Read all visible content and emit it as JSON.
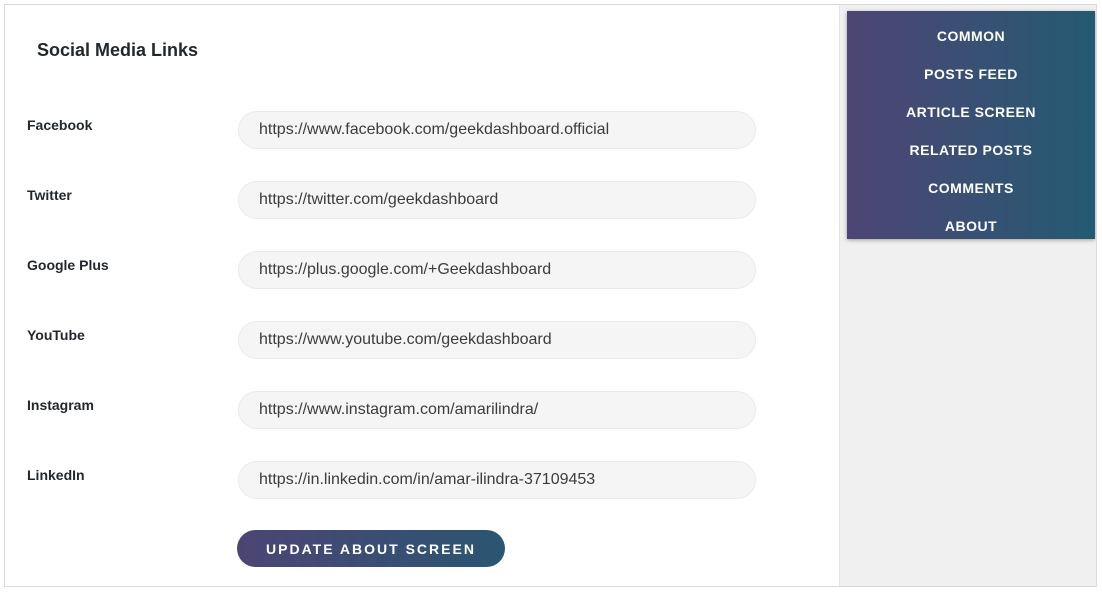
{
  "section": {
    "title": "Social Media Links"
  },
  "fields": [
    {
      "label": "Facebook",
      "value": "https://www.facebook.com/geekdashboard.official"
    },
    {
      "label": "Twitter",
      "value": "https://twitter.com/geekdashboard"
    },
    {
      "label": "Google Plus",
      "value": "https://plus.google.com/+Geekdashboard"
    },
    {
      "label": "YouTube",
      "value": "https://www.youtube.com/geekdashboard"
    },
    {
      "label": "Instagram",
      "value": "https://www.instagram.com/amarilindra/"
    },
    {
      "label": "LinkedIn",
      "value": "https://in.linkedin.com/in/amar-ilindra-37109453"
    }
  ],
  "actions": {
    "update_label": "UPDATE ABOUT SCREEN"
  },
  "menu": {
    "items": [
      {
        "label": "COMMON"
      },
      {
        "label": "POSTS FEED"
      },
      {
        "label": "ARTICLE SCREEN"
      },
      {
        "label": "RELATED POSTS"
      },
      {
        "label": "COMMENTS"
      },
      {
        "label": "ABOUT"
      }
    ]
  },
  "colors": {
    "accent_start": "#4d4574",
    "accent_end": "#2a5672"
  }
}
